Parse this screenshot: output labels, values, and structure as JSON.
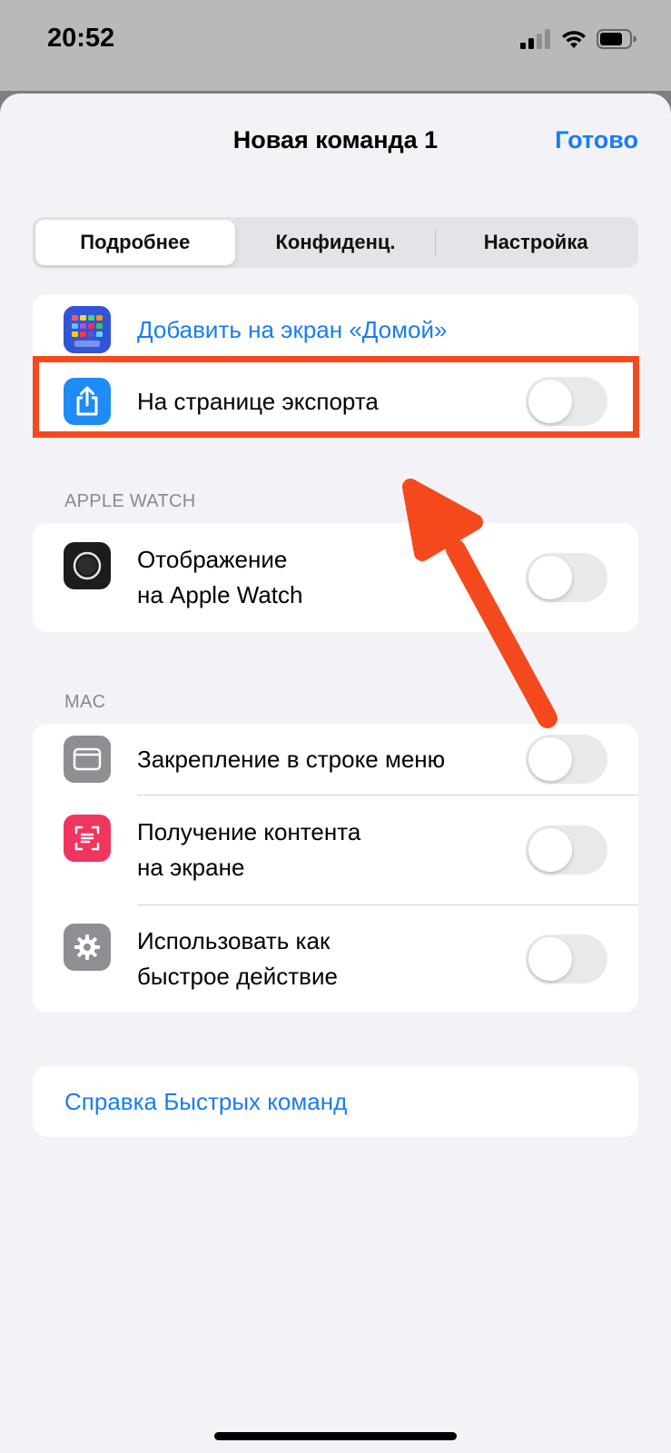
{
  "status_bar": {
    "time": "20:52"
  },
  "nav": {
    "title": "Новая команда 1",
    "done": "Готово"
  },
  "tabs": [
    {
      "label": "Подробнее",
      "active": true
    },
    {
      "label": "Конфиденц.",
      "active": false
    },
    {
      "label": "Настройка",
      "active": false
    }
  ],
  "general": {
    "home_screen": "Добавить на экран «Домой»",
    "share_sheet": "На странице экспорта",
    "share_sheet_toggle": false
  },
  "apple_watch": {
    "header": "APPLE WATCH",
    "show_on_watch": "Отображение\nна Apple Watch",
    "show_on_watch_toggle": false
  },
  "mac": {
    "header": "MAC",
    "menu_bar": "Закрепление в строке меню",
    "menu_bar_toggle": false,
    "screen_content": "Получение контента\nна экране",
    "screen_content_toggle": false,
    "quick_action": "Использовать как\nбыстрое действие",
    "quick_action_toggle": false
  },
  "help": {
    "link": "Справка Быстрых команд"
  },
  "colors": {
    "accent": "#1a7cf5",
    "annotation": "#f4491d",
    "share_icon_bg": "#1f8bf5",
    "screen_icon_bg": "#f0355f",
    "gray_icon_bg": "#8e8e93"
  }
}
